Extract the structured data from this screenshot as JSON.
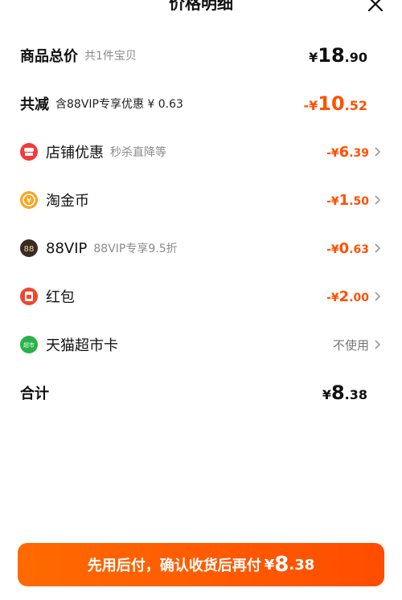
{
  "header": {
    "title": "价格明细"
  },
  "total_goods": {
    "label": "商品总价",
    "sub": "共1件宝贝",
    "currency": "¥",
    "int": "18",
    "dec": ".90"
  },
  "reduction": {
    "label": "共减",
    "sub": "含88VIP专享优惠 ¥ 0.63",
    "prefix": "-",
    "currency": "¥",
    "int": "10",
    "dec": ".52"
  },
  "discounts": [
    {
      "label": "店铺优惠",
      "sub": "秒杀直降等",
      "prefix": "-",
      "currency": "¥",
      "int": "6",
      "dec": ".39",
      "icon": "shop-icon",
      "color": "#f23a3a"
    },
    {
      "label": "淘金币",
      "sub": "",
      "prefix": "-",
      "currency": "¥",
      "int": "1",
      "dec": ".50",
      "icon": "taojinbi-icon",
      "color": "#f5a623"
    },
    {
      "label": "88VIP",
      "sub": "88VIP专享9.5折",
      "prefix": "-",
      "currency": "¥",
      "int": "0",
      "dec": ".63",
      "icon": "vip88-icon",
      "color": "#3a2b20",
      "icon_text": "88"
    },
    {
      "label": "红包",
      "sub": "",
      "prefix": "-",
      "currency": "¥",
      "int": "2",
      "dec": ".00",
      "icon": "red-packet-icon",
      "color": "#f2452b"
    }
  ],
  "supermarket_card": {
    "label": "天猫超市卡",
    "value": "不使用",
    "icon": "tmall-supermarket-icon",
    "icon_text": "超市"
  },
  "sum": {
    "label": "合计",
    "currency": "¥",
    "int": "8",
    "dec": ".38"
  },
  "pay_button": {
    "text": "先用后付，确认收货后再付",
    "currency": "¥",
    "int": "8",
    "dec": ".38"
  },
  "colors": {
    "accent": "#ff5000",
    "muted": "#8a8a8a"
  }
}
